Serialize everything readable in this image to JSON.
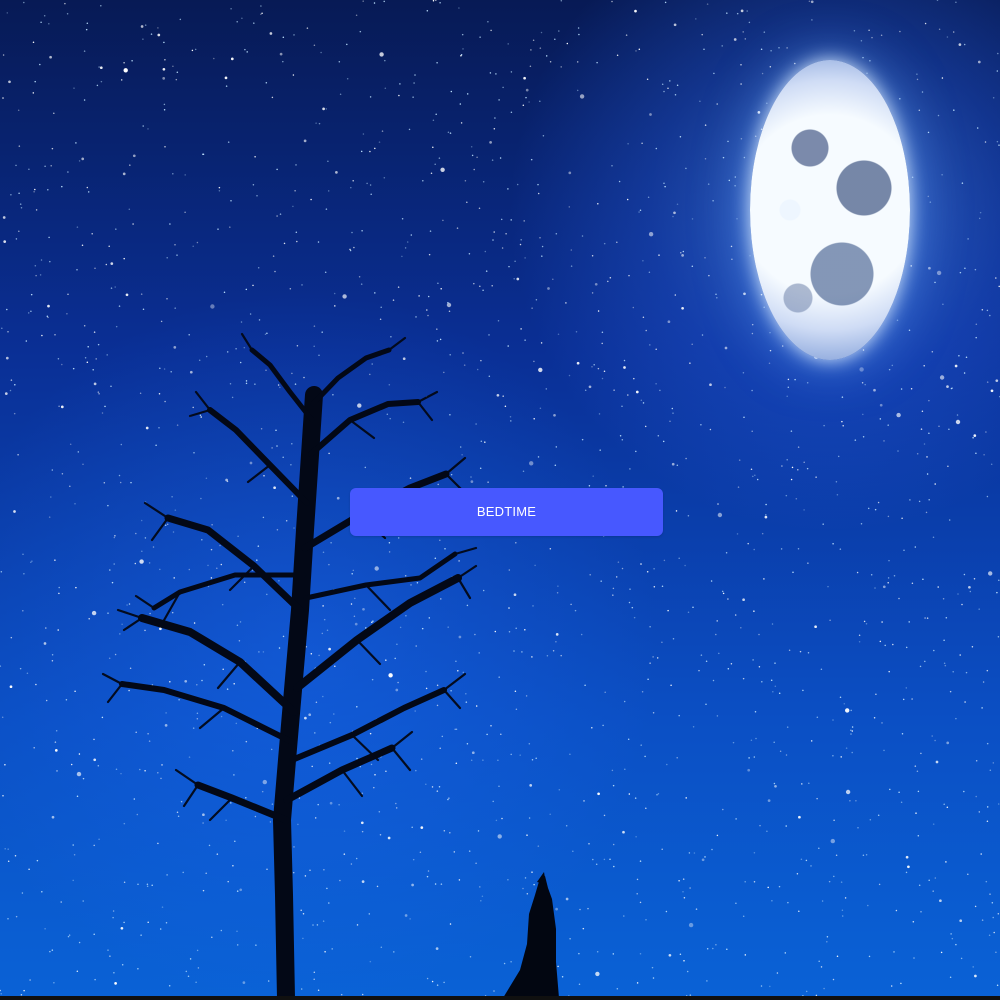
{
  "scene": {
    "colors": {
      "sky_top": "#071a55",
      "sky_bottom": "#0a62d6",
      "button_bg": "#4758ff",
      "button_text": "#ffffff"
    }
  },
  "button": {
    "label": "BEDTIME"
  }
}
